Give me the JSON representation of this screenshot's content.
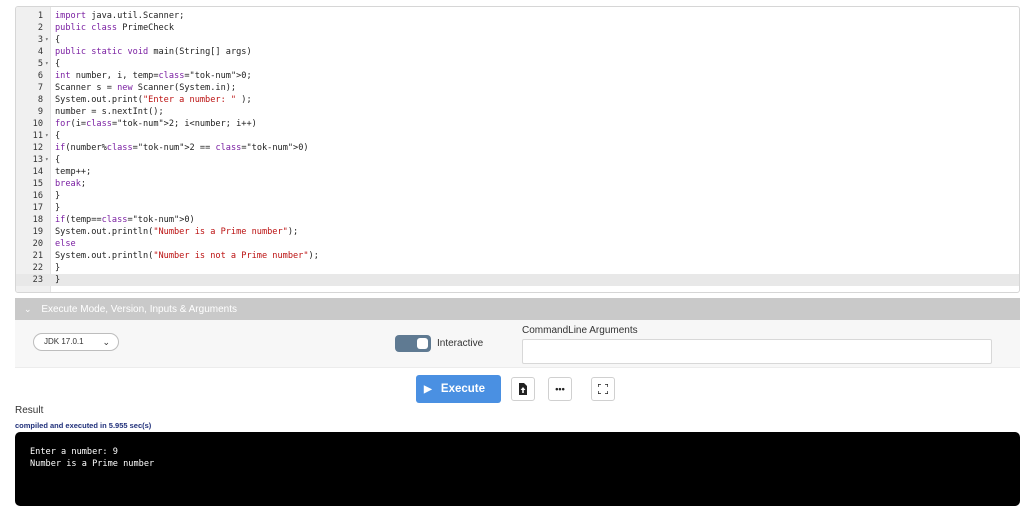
{
  "editor": {
    "lines": [
      {
        "n": "1",
        "fold": "",
        "code": "import java.util.Scanner;"
      },
      {
        "n": "2",
        "fold": "",
        "code": "public class PrimeCheck"
      },
      {
        "n": "3",
        "fold": "▾",
        "code": "{"
      },
      {
        "n": "4",
        "fold": "",
        "code": "public static void main(String[] args)"
      },
      {
        "n": "5",
        "fold": "▾",
        "code": "{"
      },
      {
        "n": "6",
        "fold": "",
        "code": "int number, i, temp=0;"
      },
      {
        "n": "7",
        "fold": "",
        "code": "Scanner s = new Scanner(System.in);"
      },
      {
        "n": "8",
        "fold": "",
        "code": "System.out.print(\"Enter a number: \" );"
      },
      {
        "n": "9",
        "fold": "",
        "code": "number = s.nextInt();"
      },
      {
        "n": "10",
        "fold": "",
        "code": "for(i=2; i<number; i++)"
      },
      {
        "n": "11",
        "fold": "▾",
        "code": "{"
      },
      {
        "n": "12",
        "fold": "",
        "code": "if(number%2 == 0)"
      },
      {
        "n": "13",
        "fold": "▾",
        "code": "{"
      },
      {
        "n": "14",
        "fold": "",
        "code": "temp++;"
      },
      {
        "n": "15",
        "fold": "",
        "code": "break;"
      },
      {
        "n": "16",
        "fold": "",
        "code": "}"
      },
      {
        "n": "17",
        "fold": "",
        "code": "}"
      },
      {
        "n": "18",
        "fold": "",
        "code": "if(temp==0)"
      },
      {
        "n": "19",
        "fold": "",
        "code": "System.out.println(\"Number is a Prime number\");"
      },
      {
        "n": "20",
        "fold": "",
        "code": "else"
      },
      {
        "n": "21",
        "fold": "",
        "code": "System.out.println(\"Number is not a Prime number\");"
      },
      {
        "n": "22",
        "fold": "",
        "code": "}"
      },
      {
        "n": "23",
        "fold": "",
        "code": "}"
      }
    ],
    "active_line": 23
  },
  "execute_section": {
    "title": "Execute Mode, Version, Inputs & Arguments",
    "chevron_icon": "chevron-down-icon"
  },
  "controls": {
    "jdk_version": "JDK 17.0.1",
    "interactive_label": "Interactive",
    "interactive_on": true,
    "args_label": "CommandLine Arguments",
    "args_value": ""
  },
  "toolbar": {
    "execute_label": "Execute",
    "icons": [
      "upload-file-icon",
      "more-options-icon",
      "fullscreen-icon"
    ]
  },
  "result": {
    "label": "Result",
    "compile_message": "compiled and executed in 5.955 sec(s)",
    "output_lines": [
      "Enter a number: 9",
      "Number is a Prime number"
    ]
  },
  "colors": {
    "execute_button": "#4a90e2",
    "toggle": "#5f7a92",
    "terminal_bg": "#000000",
    "compile_message": "#1f2f7a"
  }
}
